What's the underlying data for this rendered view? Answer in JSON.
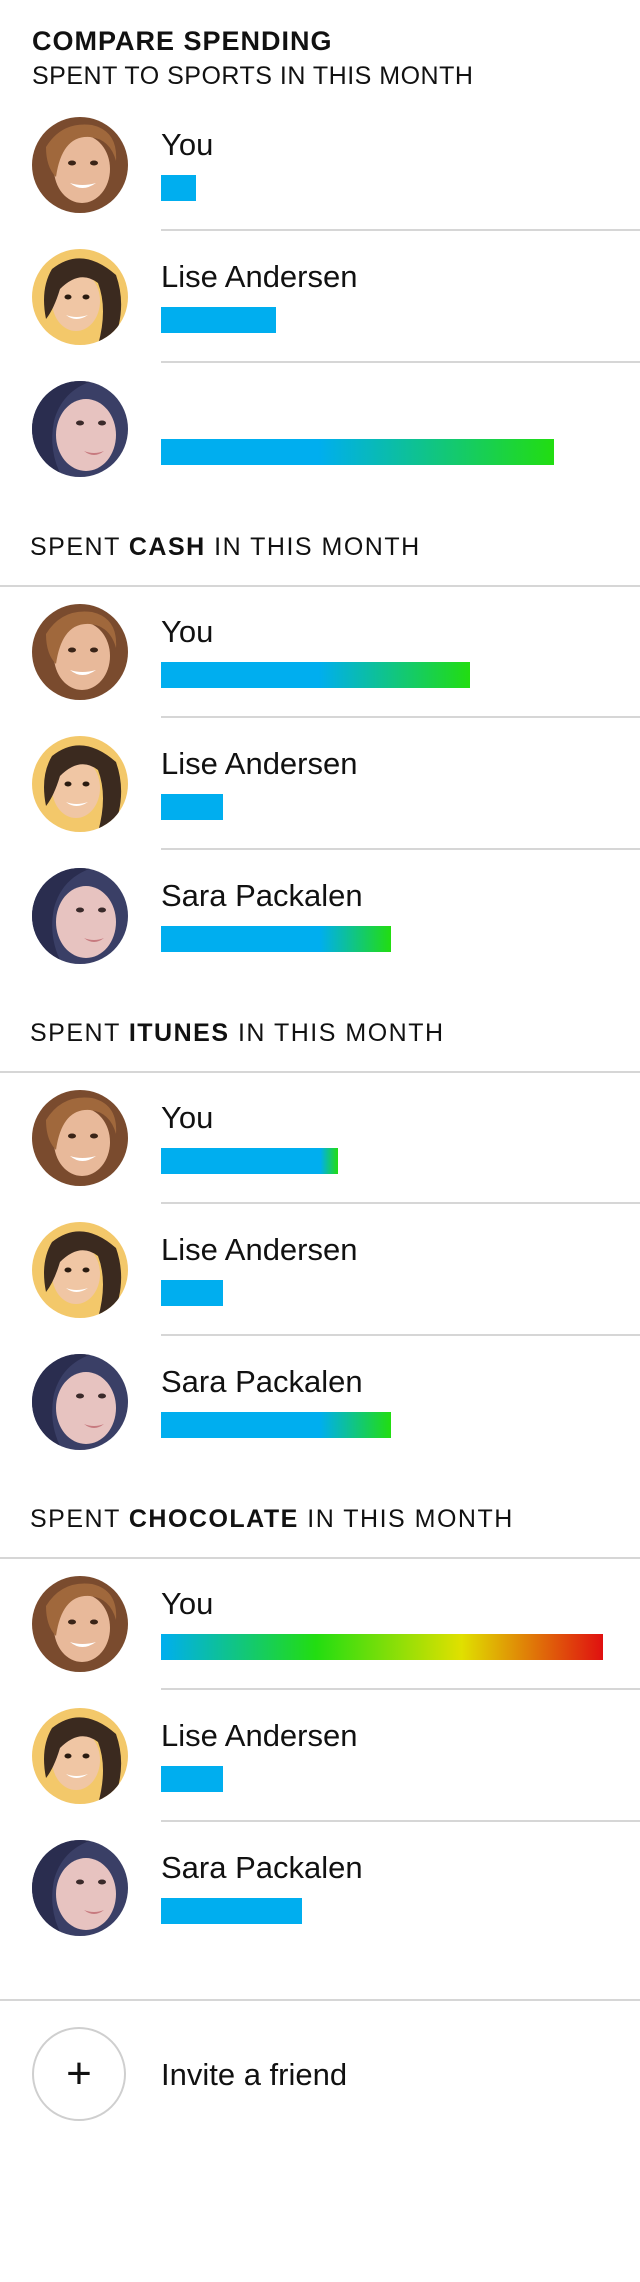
{
  "header": {
    "title": "COMPARE SPENDING",
    "subtitle": "SPENT TO SPORTS IN THIS MONTH"
  },
  "colors": {
    "bar_blue": "#00aeef",
    "bar_green": "#22dd11",
    "bar_yellow": "#e0e000",
    "bar_red": "#e01010",
    "divider": "#d6d6d6"
  },
  "sections": [
    {
      "category": "SPORTS",
      "rows": [
        {
          "name": "You",
          "avatar": "avatar-you",
          "amount": 0.08
        },
        {
          "name": "Lise Andersen",
          "avatar": "avatar-lise",
          "amount": 0.26
        },
        {
          "name": "",
          "avatar": "avatar-sara",
          "amount": 0.89
        }
      ]
    },
    {
      "prefix": "SPENT ",
      "category": "CASH",
      "suffix": " IN THIS MONTH",
      "rows": [
        {
          "name": "You",
          "avatar": "avatar-you",
          "amount": 0.7
        },
        {
          "name": "Lise Andersen",
          "avatar": "avatar-lise",
          "amount": 0.14
        },
        {
          "name": "Sara Packalen",
          "avatar": "avatar-sara",
          "amount": 0.52
        }
      ]
    },
    {
      "prefix": "SPENT ",
      "category": "ITUNES",
      "suffix": " IN THIS MONTH",
      "rows": [
        {
          "name": "You",
          "avatar": "avatar-you",
          "amount": 0.4
        },
        {
          "name": "Lise Andersen",
          "avatar": "avatar-lise",
          "amount": 0.14
        },
        {
          "name": "Sara Packalen",
          "avatar": "avatar-sara",
          "amount": 0.52
        }
      ]
    },
    {
      "prefix": "SPENT ",
      "category": "CHOCOLATE",
      "suffix": " IN THIS MONTH",
      "rows": [
        {
          "name": "You",
          "avatar": "avatar-you",
          "amount": 1.0
        },
        {
          "name": "Lise Andersen",
          "avatar": "avatar-lise",
          "amount": 0.14
        },
        {
          "name": "Sara Packalen",
          "avatar": "avatar-sara",
          "amount": 0.32
        }
      ]
    }
  ],
  "invite": {
    "icon": "plus-icon",
    "label": "Invite a friend"
  }
}
